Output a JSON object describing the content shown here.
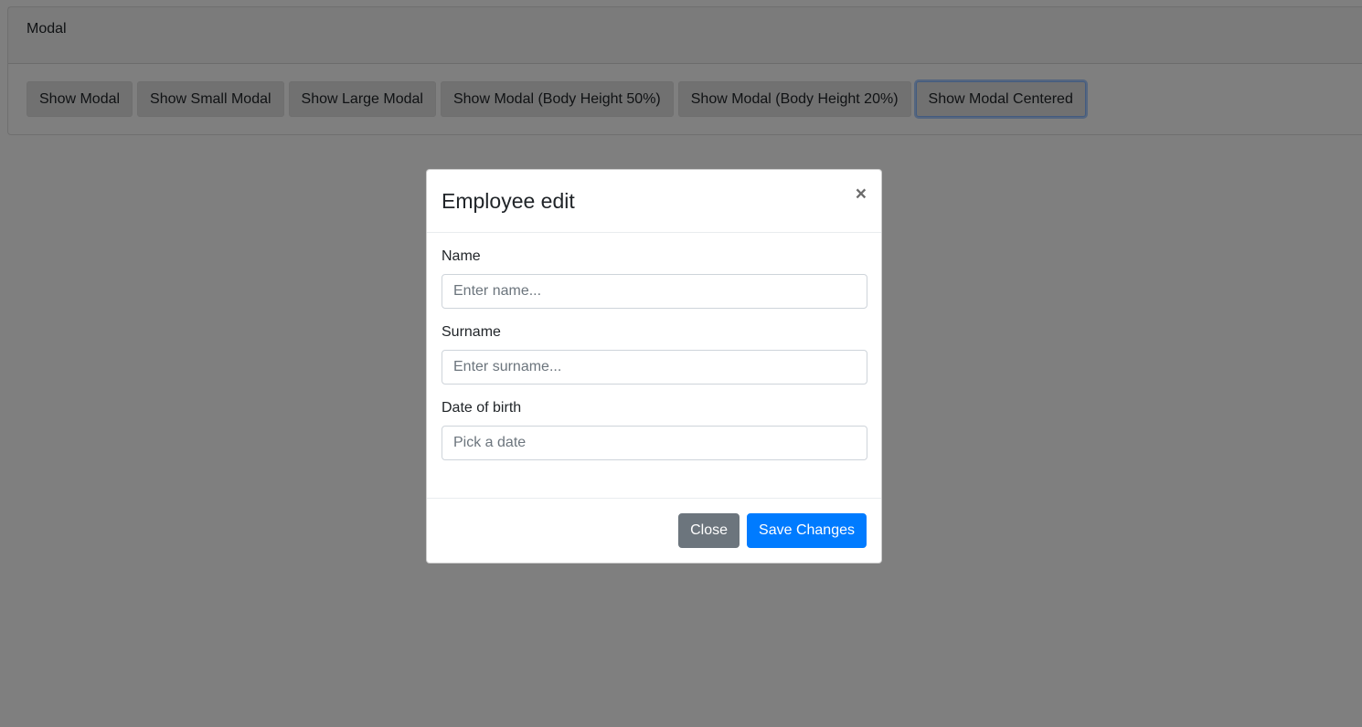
{
  "card": {
    "header_title": "Modal",
    "buttons": [
      {
        "label": "Show Modal"
      },
      {
        "label": "Show Small Modal"
      },
      {
        "label": "Show Large Modal"
      },
      {
        "label": "Show Modal (Body Height 50%)"
      },
      {
        "label": "Show Modal (Body Height 20%)"
      },
      {
        "label": "Show Modal Centered"
      }
    ]
  },
  "modal": {
    "title": "Employee edit",
    "close_symbol": "×",
    "fields": [
      {
        "label": "Name",
        "placeholder": "Enter name...",
        "value": ""
      },
      {
        "label": "Surname",
        "placeholder": "Enter surname...",
        "value": ""
      },
      {
        "label": "Date of birth",
        "placeholder": "Pick a date",
        "value": ""
      }
    ],
    "footer": {
      "close_label": "Close",
      "save_label": "Save Changes"
    }
  },
  "colors": {
    "primary": "#007bff",
    "secondary": "#6c757d",
    "backdrop": "rgba(0,0,0,0.5)"
  }
}
